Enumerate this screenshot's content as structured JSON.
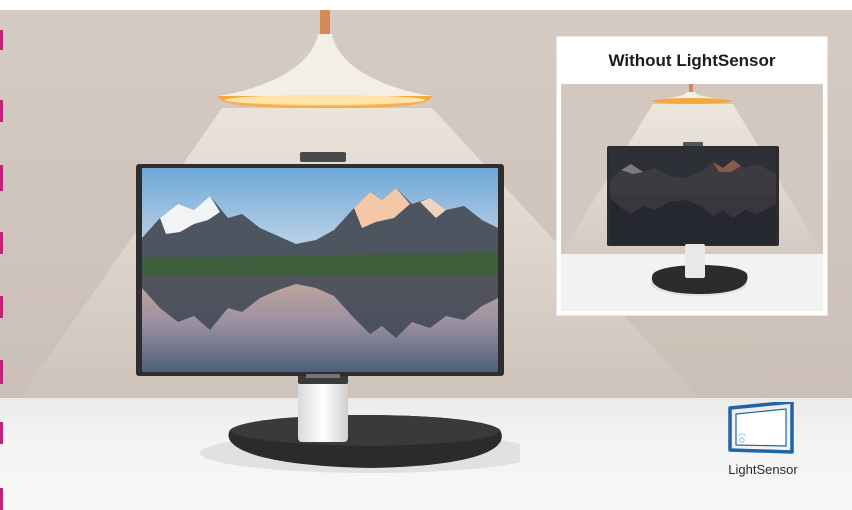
{
  "inset": {
    "title": "Without LightSensor"
  },
  "badge": {
    "label": "LightSensor",
    "icon": "lightsensor-icon"
  },
  "colors": {
    "wall": "#d1c6bd",
    "floor": "#f3f3f2",
    "accent_edge": "#c0237a",
    "sensor_icon": "#1f64a8",
    "lamp_glow": "#f6b44a",
    "lamp_cord": "#d48a57"
  }
}
